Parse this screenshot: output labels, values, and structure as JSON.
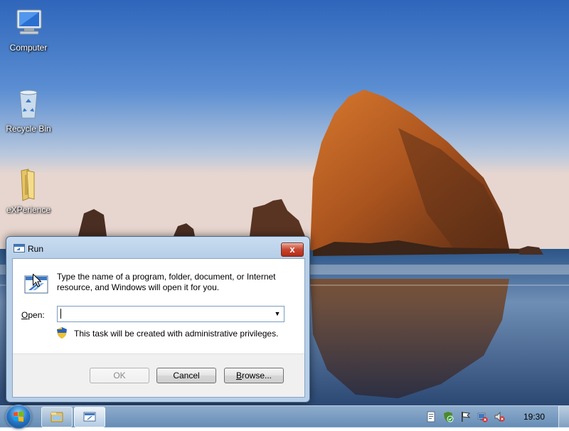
{
  "desktop": {
    "icons": [
      {
        "label": "Computer",
        "icon": "computer-icon"
      },
      {
        "label": "Recycle Bin",
        "icon": "recycle-bin-icon"
      },
      {
        "label": "eXPerience",
        "icon": "folder-icon"
      }
    ]
  },
  "run_dialog": {
    "title": "Run",
    "description": "Type the name of a program, folder, document, or Internet resource, and Windows will open it for you.",
    "open_label_underlined": "O",
    "open_label_rest": "pen:",
    "open_value": "",
    "uac_note": "This task will be created with administrative privileges.",
    "buttons": {
      "ok": "OK",
      "cancel": "Cancel",
      "browse_underlined": "B",
      "browse_rest": "rowse..."
    },
    "close_glyph": "x"
  },
  "taskbar": {
    "clock": "19:30",
    "pinned": [
      "explorer-icon",
      "run-icon"
    ],
    "tray_icons": [
      "document-icon",
      "security-shield-icon",
      "action-center-flag-icon",
      "network-icon",
      "volume-muted-icon"
    ]
  },
  "colors": {
    "sky_top": "#3a6fc0",
    "sky_bottom": "#cfd9e6",
    "accent": "#2a78c8"
  }
}
